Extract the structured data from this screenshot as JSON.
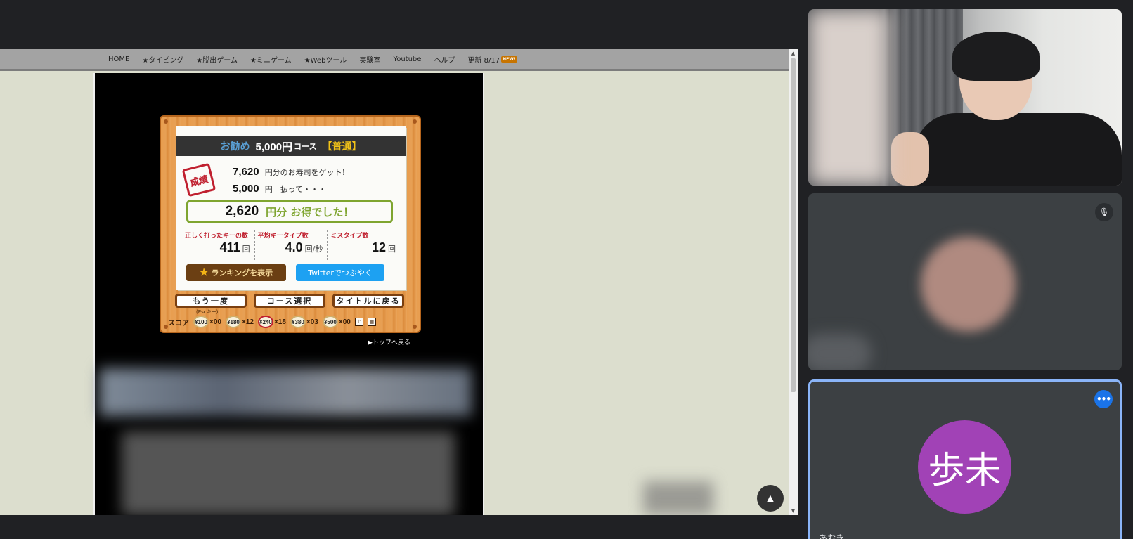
{
  "nav": {
    "items": [
      "HOME",
      "★タイピング",
      "★脱出ゲーム",
      "★ミニゲーム",
      "★Webツール",
      "実験室",
      "Youtube",
      "ヘルプ"
    ],
    "update_label": "更新 8/17",
    "new_badge": "NEW!"
  },
  "result": {
    "course_prefix": "お勧め",
    "course_price": "5,000円",
    "course_suffix": "コース",
    "course_level": "【普通】",
    "stamp": "成績",
    "got_amount": "7,620",
    "got_text": "円分のお寿司をゲット!",
    "paid_amount": "5,000",
    "paid_text": "円　払って・・・",
    "profit_amount": "2,620",
    "profit_text": "円分 お得でした！",
    "stats": [
      {
        "label": "正しく打ったキーの数",
        "value": "411",
        "unit": "回"
      },
      {
        "label": "平均キータイプ数",
        "value": "4.0",
        "unit": "回/秒"
      },
      {
        "label": "ミスタイプ数",
        "value": "12",
        "unit": "回"
      }
    ],
    "ranking_label": "ランキングを表示",
    "twitter_label": "Twitterでつぶやく",
    "retry_label": "もう一度",
    "course_select_label": "コース選択",
    "title_label": "タイトルに戻る",
    "esc_hint": "(Escキー)",
    "score_label": "スコア",
    "plates": [
      {
        "price": "¥100",
        "count": "×00",
        "red": false
      },
      {
        "price": "¥180",
        "count": "×12",
        "red": false
      },
      {
        "price": "¥240",
        "count": "×18",
        "red": true
      },
      {
        "price": "¥380",
        "count": "×03",
        "red": false
      },
      {
        "price": "¥500",
        "count": "×00",
        "red": false
      }
    ],
    "top_link": "▶トップへ戻る"
  },
  "participants": {
    "self_initials": "歩未",
    "self_name": "あおき"
  },
  "icons": {
    "star": "star-icon",
    "mic_off": "mic-off-icon",
    "more": "more-options-icon",
    "scroll_top": "arrow-up-icon"
  },
  "colors": {
    "accent_profit": "#7fa530",
    "twitter": "#1da1f2",
    "self_avatar": "#a142b6",
    "active_border": "#8ab4f8"
  }
}
